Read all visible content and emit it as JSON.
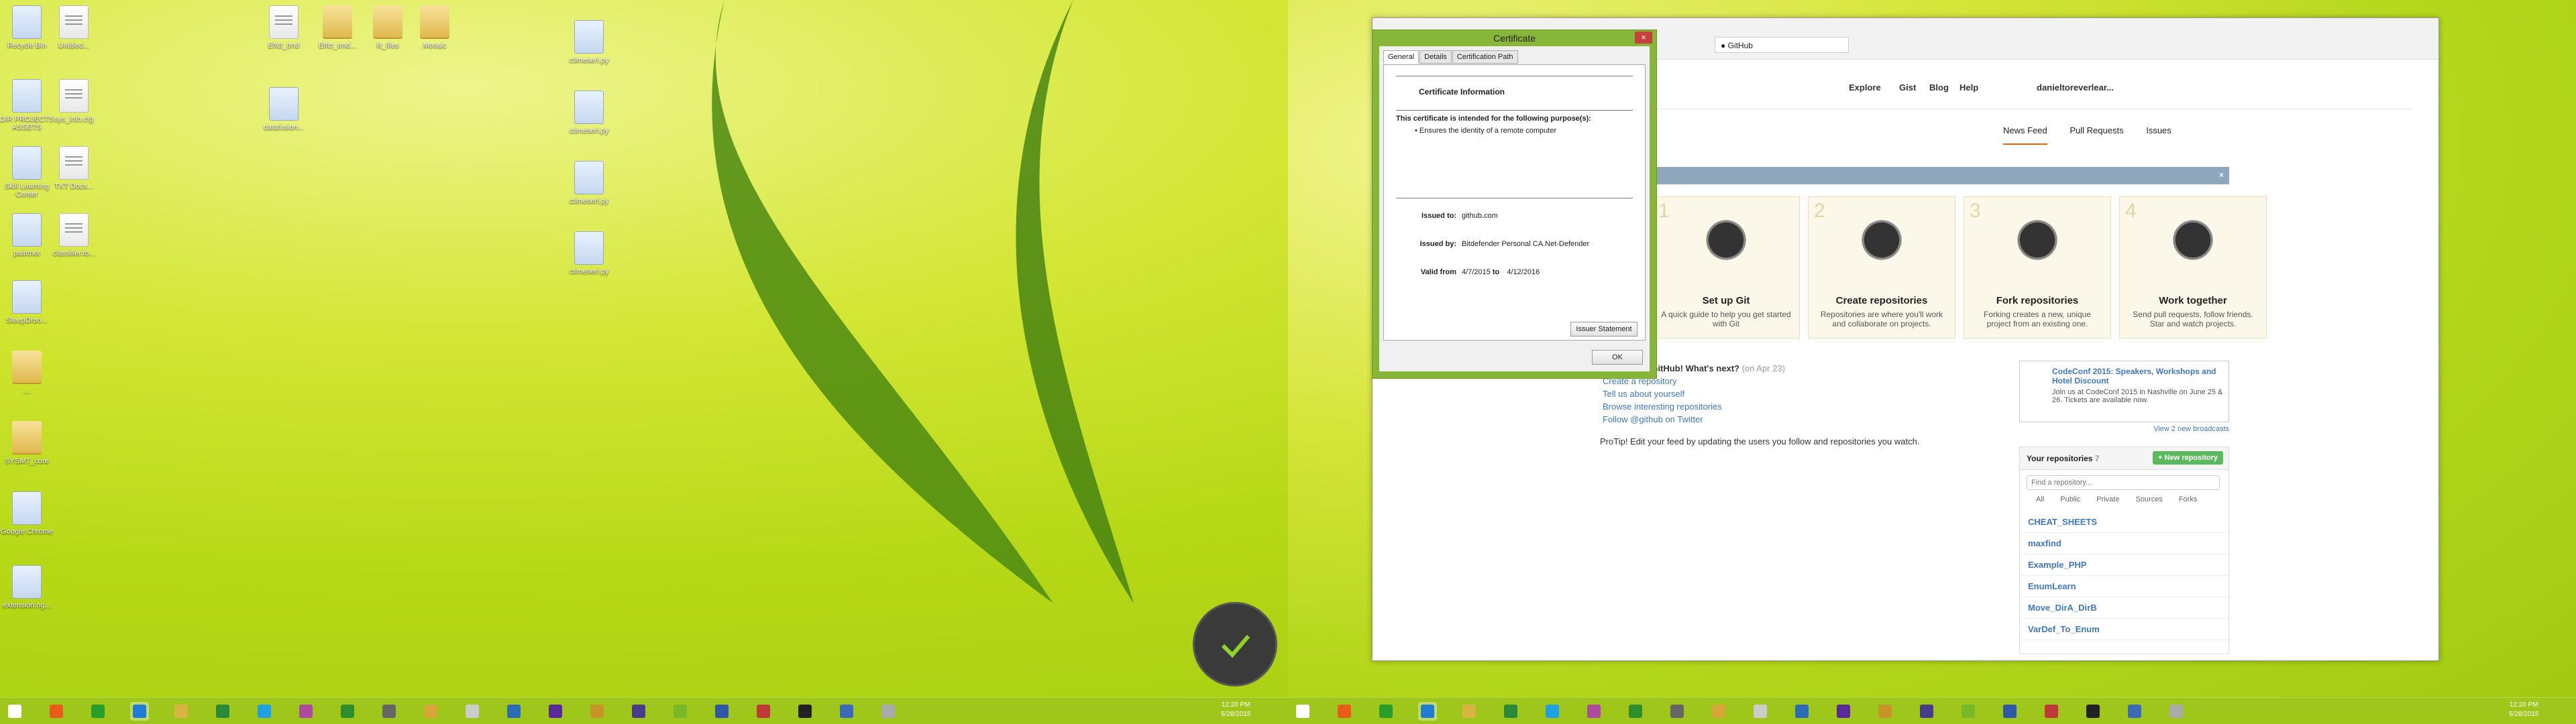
{
  "desktop_icons": [
    {
      "label": "Recycle Bin",
      "kind": "bin"
    },
    {
      "label": "Untitled...",
      "kind": "doc"
    },
    {
      "label": "DIR PROJECTS ASSETS",
      "kind": "shrt"
    },
    {
      "label": "sys_info.cfg",
      "kind": "doc"
    },
    {
      "label": "Skill Learning Center",
      "kind": "help"
    },
    {
      "label": "TXT Docs...",
      "kind": "doc"
    },
    {
      "label": "paintnet",
      "kind": "shrt"
    },
    {
      "label": "classifier.fo...",
      "kind": "doc"
    },
    {
      "label": "SteepDroo...",
      "kind": "app"
    },
    {
      "label": "....",
      "kind": "fold"
    },
    {
      "label": "SYSMT_core",
      "kind": "fold"
    },
    {
      "label": "Google Chrome",
      "kind": "chrome"
    },
    {
      "label": "extension.ng...",
      "kind": "shrt"
    }
  ],
  "desktop_icons_2": [
    {
      "label": "Effct_trnd",
      "kind": "doc"
    },
    {
      "label": "Effct_trnd...",
      "kind": "fold"
    },
    {
      "label": "lit_files",
      "kind": "fold"
    },
    {
      "label": "Mosaic",
      "kind": "fold"
    },
    {
      "label": "datafusion...",
      "kind": "shrt"
    },
    {
      "label": "ctimeseri.py",
      "kind": "shrt"
    },
    {
      "label": "ctimeseri.py",
      "kind": "shrt"
    },
    {
      "label": "ctimeseri.py",
      "kind": "shrt"
    },
    {
      "label": "ctimeseri.py",
      "kind": "shrt"
    }
  ],
  "browser": {
    "tab_title": "GitHub",
    "nav": {
      "explore": "Explore",
      "gist": "Gist",
      "blog": "Blog",
      "help": "Help",
      "user": "danieltoreverlear..."
    },
    "subnav": {
      "news_feed": "News Feed",
      "pull_requests": "Pull Requests",
      "issues": "Issues"
    },
    "bootcamp": [
      {
        "num": "1",
        "title": "Set up Git",
        "desc": "A quick guide to help you get started with Git"
      },
      {
        "num": "2",
        "title": "Create repositories",
        "desc": "Repositories are where you'll work and collaborate on projects."
      },
      {
        "num": "3",
        "title": "Fork repositories",
        "desc": "Forking creates a new, unique project from an existing one."
      },
      {
        "num": "4",
        "title": "Work together",
        "desc": "Send pull requests, follow friends. Star and watch projects."
      }
    ],
    "welcome": "Welcome to GitHub! What's next?",
    "welcome_date": "(on Apr 23)",
    "welcome_links": [
      "Create a repository",
      "Tell us about yourself",
      "Browse interesting repositories",
      "Follow @github on Twitter"
    ],
    "protip": "ProTip! Edit your feed by updating the users you follow and repositories you watch.",
    "broadcast": {
      "title": "CodeConf 2015: Speakers, Workshops and Hotel Discount",
      "body": "Join us at CodeConf 2015 in Nashville on June 25 & 26. Tickets are available now.",
      "more": "View 2 new broadcasts"
    },
    "repos": {
      "header": "Your repositories",
      "count": "7",
      "new": "+ New repository",
      "find": "Find a repository...",
      "filters": [
        "All",
        "Public",
        "Private",
        "Sources",
        "Forks"
      ],
      "list": [
        "CHEAT_SHEETS",
        "maxfind",
        "Example_PHP",
        "EnumLearn",
        "Move_DirA_DirB",
        "VarDef_To_Enum"
      ]
    }
  },
  "cert": {
    "title": "Certificate",
    "tabs": [
      "General",
      "Details",
      "Certification Path"
    ],
    "heading": "Certificate Information",
    "purpose_intro": "This certificate is intended for the following purpose(s):",
    "purpose": "• Ensures the identity of a remote computer",
    "issued_to_label": "Issued to:",
    "issued_to": "github.com",
    "issued_by_label": "Issued by:",
    "issued_by": "Bitdefender Personal CA.Net-Defender",
    "valid_label": "Valid from",
    "valid_from": "4/7/2015",
    "valid_to_label": "to",
    "valid_to": "4/12/2016",
    "issuer_btn": "Issuer Statement",
    "ok": "OK"
  },
  "taskbar": {
    "time": "12:20 PM",
    "date": "5/28/2015",
    "time2": "12:20 PM",
    "date2": "5/28/2015"
  }
}
